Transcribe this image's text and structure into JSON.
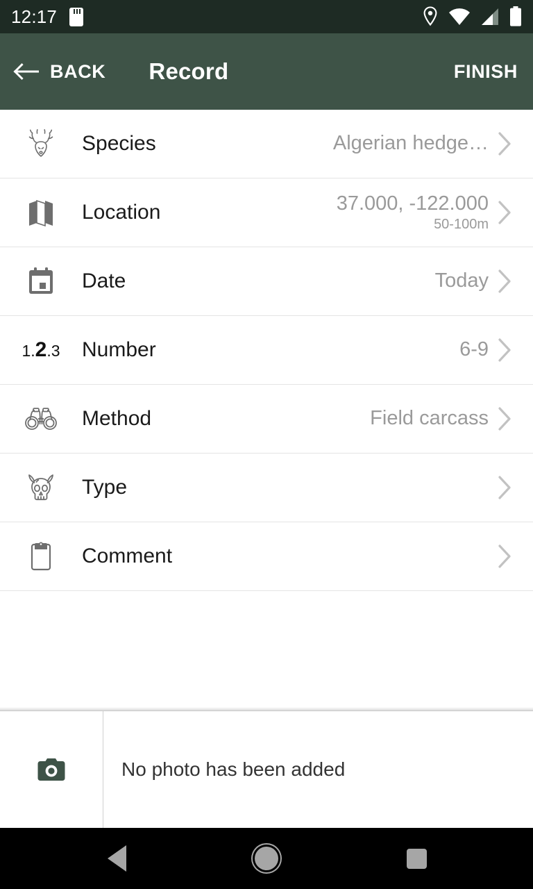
{
  "statusbar": {
    "time": "12:17",
    "icons": [
      "sdcard-icon",
      "location-icon",
      "wifi-icon",
      "signal-icon",
      "battery-icon"
    ]
  },
  "appbar": {
    "back_label": "BACK",
    "title": "Record",
    "finish_label": "FINISH",
    "bg_color": "#3e5347"
  },
  "rows": [
    {
      "icon": "deer-head-icon",
      "label": "Species",
      "value": "Algerian hedge…",
      "sub": ""
    },
    {
      "icon": "map-icon",
      "label": "Location",
      "value": "37.000, -122.000",
      "sub": "50-100m"
    },
    {
      "icon": "calendar-icon",
      "label": "Date",
      "value": "Today",
      "sub": ""
    },
    {
      "icon": "number-123-icon",
      "label": "Number",
      "value": "6-9",
      "sub": ""
    },
    {
      "icon": "binoculars-icon",
      "label": "Method",
      "value": "Field carcass",
      "sub": ""
    },
    {
      "icon": "horned-skull-icon",
      "label": "Type",
      "value": "",
      "sub": ""
    },
    {
      "icon": "clipboard-icon",
      "label": "Comment",
      "value": "",
      "sub": ""
    }
  ],
  "photo": {
    "icon": "camera-icon",
    "message": "No photo has been added",
    "icon_color": "#3e5347"
  },
  "navbar": {
    "back": "nav-back-icon",
    "home": "nav-home-icon",
    "recent": "nav-recent-icon"
  }
}
